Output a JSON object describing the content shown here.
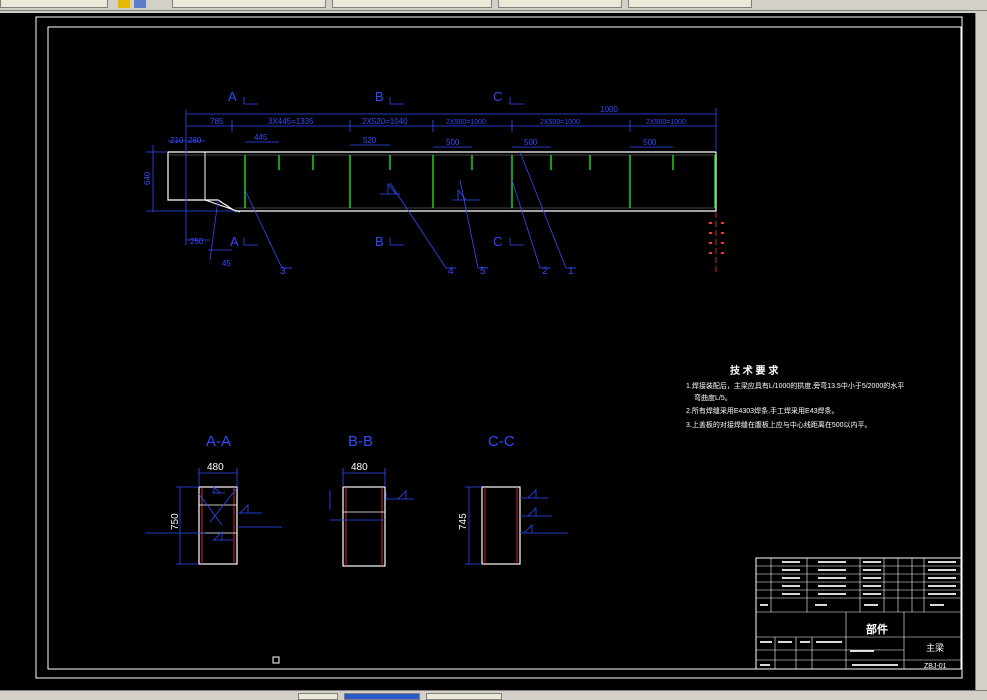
{
  "window": {
    "tabs": [
      "",
      "",
      "",
      "",
      ""
    ]
  },
  "drawing": {
    "total_dim": "1000",
    "top_dims": [
      "785",
      "3X445=1335",
      "2X520=1040",
      "2X500=1000",
      "2X500=1000",
      "2X500=1000"
    ],
    "sub_dims": [
      "445",
      "520",
      "500",
      "500",
      "500"
    ],
    "left_dims": [
      "210",
      "280"
    ],
    "height_dim": "640",
    "bottom_dims": [
      "250",
      "45"
    ],
    "section_marks": [
      "A",
      "B",
      "C"
    ],
    "balloons": [
      "3",
      "4",
      "5",
      "2",
      "1"
    ],
    "sections": [
      {
        "title": "A-A",
        "width": "480",
        "height": "750"
      },
      {
        "title": "B-B",
        "width": "480",
        "height": ""
      },
      {
        "title": "C-C",
        "width": "",
        "height": "745"
      }
    ],
    "tech_req": {
      "title": "技 术 要 求",
      "lines": [
        "1.焊接装配后，主梁应具有L/1000的拱度,旁弯13.5中小于5/2000的水平",
        "弯曲度L/5。",
        "2.所有焊缝采用E4303焊条,手工焊采用E43焊条。",
        "3.上盖板的对接焊缝在腹板上应与中心线距离在500以内平。"
      ]
    },
    "title_block": {
      "part_label": "部件",
      "name": "主梁",
      "code": "ZBJ-01"
    }
  }
}
